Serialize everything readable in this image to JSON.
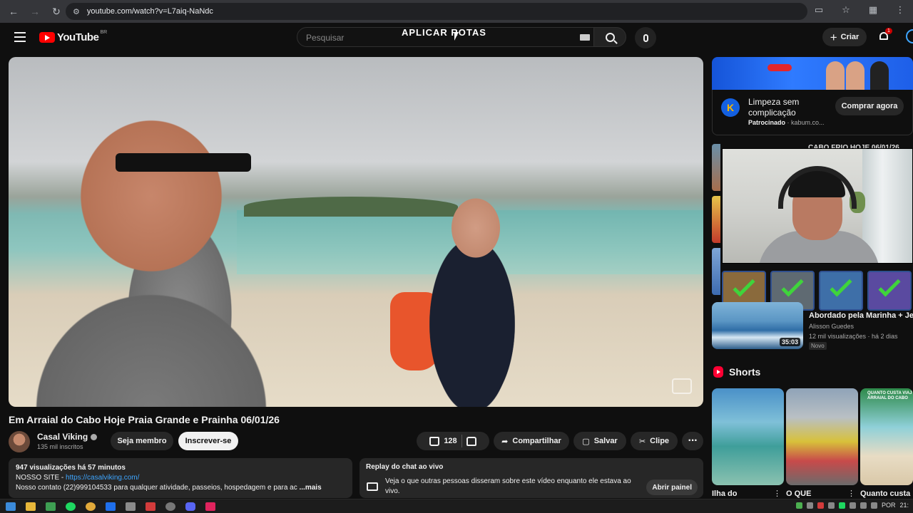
{
  "browser": {
    "url": "youtube.com/watch?v=L7aiq-NaNdc",
    "nav_icons": [
      "back-arrow-icon",
      "forward-arrow-icon",
      "reload-icon"
    ],
    "toolbar_icons": [
      "cast-icon",
      "star-icon",
      "extensions-icon",
      "menu-icon"
    ]
  },
  "header": {
    "logo_text": "YouTube",
    "country_code": "BR",
    "search_placeholder": "Pesquisar",
    "overlay_text": "APLICAR ROTAS",
    "create_label": "Criar",
    "notification_count": "1"
  },
  "video": {
    "title": "Em Arraial do Cabo Hoje Praia Grande e Prainha 06/01/26",
    "channel_name": "Casal Viking",
    "subscribers": "135 mil inscritos",
    "member_label": "Seja membro",
    "subscribe_label": "Inscrever-se",
    "likes": "128",
    "share_label": "Compartilhar",
    "save_label": "Salvar",
    "clip_label": "Clipe"
  },
  "description": {
    "meta": "947 visualizações  há 57 minutos",
    "site_label": "NOSSO SITE - ",
    "site_link": "https://casalviking.com/",
    "line3": "Nosso contato (22)999104533 para qualquer atividade, passeios, hospedagem e para ac",
    "more": "...mais"
  },
  "chat_replay": {
    "title": "Replay do chat ao vivo",
    "text": "Veja o que outras pessoas disseram sobre este vídeo enquanto ele estava ao vivo.",
    "button": "Abrir painel"
  },
  "ad": {
    "title": "Limpeza sem complicação",
    "sponsored": "Patrocinado",
    "domain": " · kabum.co...",
    "button": "Comprar agora",
    "logo_letter": "K"
  },
  "recommendations": {
    "peek_title": "CABO FRIO HOJE 06/01/26",
    "item": {
      "title": "Abordado pela Marinha + Jet ...",
      "channel": "Alisson Guedes",
      "views": "12 mil visualizações · há 2 dias",
      "badge": "Novo",
      "duration": "35:03"
    }
  },
  "shorts": {
    "heading": "Shorts",
    "items": [
      {
        "title": "Ilha do"
      },
      {
        "title": "O QUE"
      },
      {
        "title": "Quanto custa"
      }
    ],
    "banner_text": "QUANTO CUSTA VIAJ ARRAIAL DO CABO"
  },
  "taskbar": {
    "lang": "POR",
    "time": "21:"
  },
  "colors": {
    "bg": "#0f0f0f",
    "brand_red": "#ff0000",
    "link_blue": "#3ea6ff",
    "surface": "#272727"
  }
}
